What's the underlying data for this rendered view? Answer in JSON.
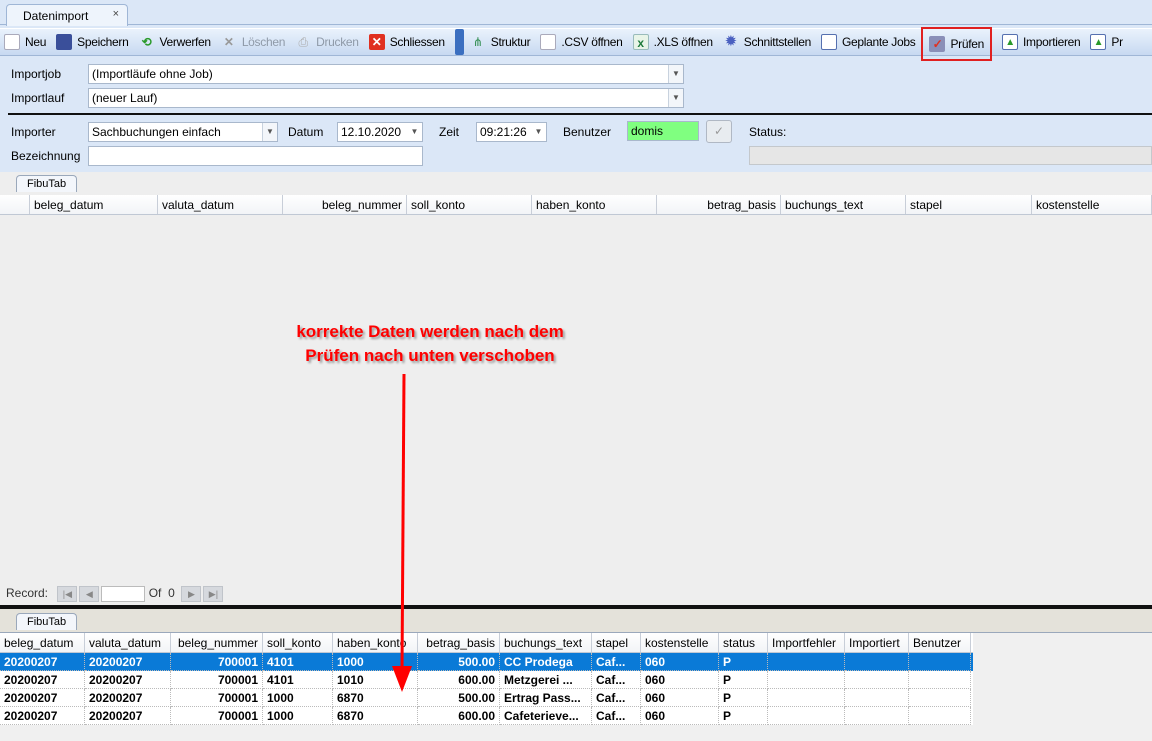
{
  "window": {
    "tab_title": "Datenimport",
    "close_glyph": "×"
  },
  "toolbar": {
    "items": [
      {
        "label": "Neu",
        "icon": "new-document-icon",
        "enabled": true
      },
      {
        "label": "Speichern",
        "icon": "save-icon",
        "enabled": true
      },
      {
        "label": "Verwerfen",
        "icon": "discard-icon",
        "enabled": true
      },
      {
        "label": "Löschen",
        "icon": "delete-icon",
        "enabled": false
      },
      {
        "label": "Drucken",
        "icon": "printer-icon",
        "enabled": false
      },
      {
        "label": "Schliessen",
        "icon": "close-icon",
        "enabled": true
      },
      {
        "label": "Struktur",
        "icon": "structure-icon",
        "enabled": true
      },
      {
        "label": ".CSV öffnen",
        "icon": "csv-file-icon",
        "enabled": true
      },
      {
        "label": ".XLS öffnen",
        "icon": "excel-icon",
        "enabled": true
      },
      {
        "label": "Schnittstellen",
        "icon": "gear-icon",
        "enabled": true
      },
      {
        "label": "Geplante Jobs",
        "icon": "calendar-icon",
        "enabled": true
      },
      {
        "label": "Prüfen",
        "icon": "check-icon",
        "enabled": true,
        "highlighted": true
      },
      {
        "label": "Importieren",
        "icon": "import-icon",
        "enabled": true
      },
      {
        "label": "Pr",
        "icon": "import-icon",
        "enabled": true
      }
    ]
  },
  "form": {
    "importjob": {
      "label": "Importjob",
      "value": "(Importläufe ohne Job)"
    },
    "importlauf": {
      "label": "Importlauf",
      "value": "(neuer Lauf)"
    },
    "importer": {
      "label": "Importer",
      "value": "Sachbuchungen einfach"
    },
    "datum": {
      "label": "Datum",
      "value": "12.10.2020"
    },
    "zeit": {
      "label": "Zeit",
      "value": "09:21:26"
    },
    "benutzer": {
      "label": "Benutzer",
      "value": "domis"
    },
    "status": {
      "label": "Status:",
      "value": ""
    },
    "bezeichnung": {
      "label": "Bezeichnung",
      "value": ""
    }
  },
  "colors": {
    "highlight_box": "#e02020",
    "selected_row": "#0a7ad7",
    "benutzer_bg": "#80ff80",
    "annotation": "#ff0000"
  },
  "upper_grid": {
    "tab": "FibuTab",
    "columns": [
      "beleg_datum",
      "valuta_datum",
      "beleg_nummer",
      "soll_konto",
      "haben_konto",
      "betrag_basis",
      "buchungs_text",
      "stapel",
      "kostenstelle"
    ],
    "navigator": {
      "label": "Record:",
      "of": "Of",
      "count": "0"
    }
  },
  "annotation": {
    "line1": "korrekte Daten werden nach dem",
    "line2": "Prüfen nach unten verschoben"
  },
  "lower_grid": {
    "tab": "FibuTab",
    "columns": [
      "beleg_datum",
      "valuta_datum",
      "beleg_nummer",
      "soll_konto",
      "haben_konto",
      "betrag_basis",
      "buchungs_text",
      "stapel",
      "kostenstelle",
      "status",
      "Importfehler",
      "Importiert",
      "Benutzer"
    ],
    "rows": [
      [
        "20200207",
        "20200207",
        "700001",
        "4101",
        "1000",
        "500.00",
        "CC Prodega",
        "Caf...",
        "060",
        "P",
        "",
        "",
        ""
      ],
      [
        "20200207",
        "20200207",
        "700001",
        "4101",
        "1010",
        "600.00",
        "Metzgerei ...",
        "Caf...",
        "060",
        "P",
        "",
        "",
        ""
      ],
      [
        "20200207",
        "20200207",
        "700001",
        "1000",
        "6870",
        "500.00",
        "Ertrag Pass...",
        "Caf...",
        "060",
        "P",
        "",
        "",
        ""
      ],
      [
        "20200207",
        "20200207",
        "700001",
        "1000",
        "6870",
        "600.00",
        "Cafeterieve...",
        "Caf...",
        "060",
        "P",
        "",
        "",
        ""
      ]
    ],
    "selected_row": 0
  }
}
